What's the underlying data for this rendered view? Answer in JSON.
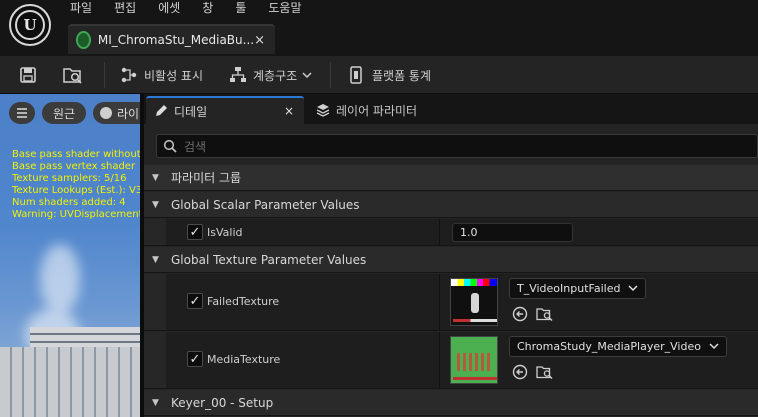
{
  "menu": [
    "파일",
    "편집",
    "에셋",
    "창",
    "툴",
    "도움말"
  ],
  "document_tab": {
    "label": "MI_ChromaStu_MediaBu...",
    "close": "×"
  },
  "toolbar": {
    "hierarchy_label": "비활성 표시",
    "layers_label": "계층구조",
    "platform_stats_label": "플랫폼 통계"
  },
  "viewport": {
    "perspective_label": "원근",
    "lit_label": "라이",
    "stats_lines": [
      "Base pass shader without",
      "Base pass vertex shader",
      "Texture samplers: 5/16",
      "Texture Lookups (Est.): V3",
      "Num shaders added: 4",
      "Warning: UVDisplacement"
    ]
  },
  "panel": {
    "details_tab": "디테일",
    "details_close": "×",
    "layer_params_tab": "레이어 파라미터",
    "search_placeholder": "검색"
  },
  "groups": {
    "param_group": "파라미터 그룹",
    "scalar": "Global Scalar Parameter Values",
    "texture": "Global Texture Parameter Values",
    "keyer": "Keyer_00 - Setup"
  },
  "params": {
    "isvalid": {
      "label": "IsValid",
      "value": "1.0",
      "checked": true
    },
    "failed_texture": {
      "label": "FailedTexture",
      "asset": "T_VideoInputFailed",
      "checked": true
    },
    "media_texture": {
      "label": "MediaTexture",
      "asset": "ChromaStudy_MediaPlayer_Video",
      "checked": true
    }
  },
  "colors": {
    "accent": "#2c7ad6",
    "stats_text": "#f2f200",
    "thumb_green": "#4caf50"
  }
}
